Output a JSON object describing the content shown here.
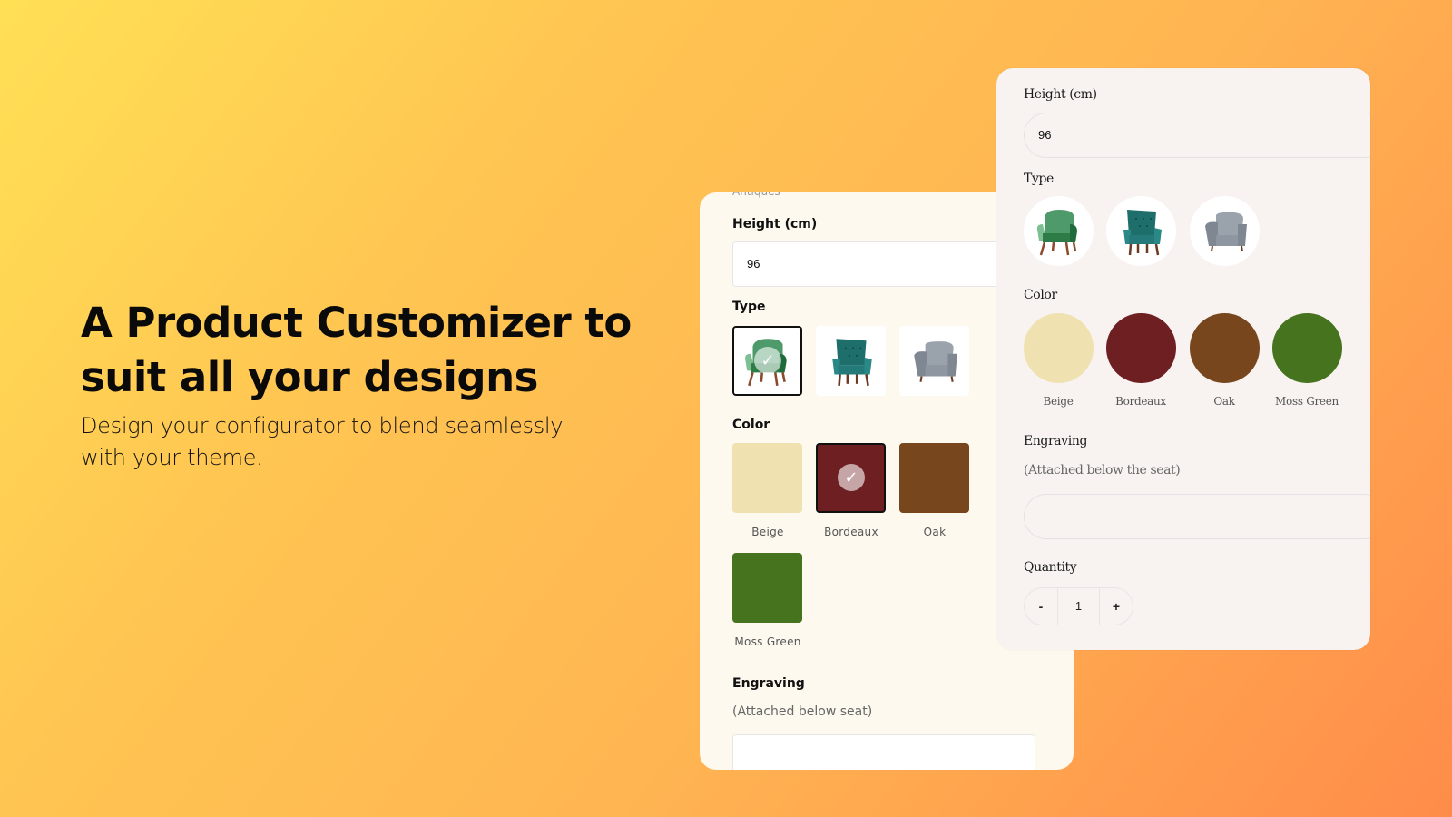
{
  "hero": {
    "title_line1": "A Product Customizer to",
    "title_line2": "suit all your designs",
    "subtitle_line1": "Design your configurator to blend seamlessly",
    "subtitle_line2": "with your theme."
  },
  "card_default": {
    "cut_label": "Antiques",
    "height_label": "Height (cm)",
    "height_value": "96",
    "type_label": "Type",
    "types": [
      {
        "name": "Green armchair",
        "icon": "armchair-green-icon",
        "selected": true
      },
      {
        "name": "Teal wingback chair",
        "icon": "armchair-teal-icon",
        "selected": false
      },
      {
        "name": "Grey armchair",
        "icon": "armchair-grey-icon",
        "selected": false
      }
    ],
    "color_label": "Color",
    "colors": [
      {
        "name": "Beige",
        "hex": "#f0e2b0",
        "selected": false
      },
      {
        "name": "Bordeaux",
        "hex": "#6e1f22",
        "selected": true
      },
      {
        "name": "Oak",
        "hex": "#77461d",
        "selected": false
      },
      {
        "name": "Moss Green",
        "hex": "#46731d",
        "selected": false
      }
    ],
    "engraving_label": "Engraving",
    "engraving_hint": "(Attached below seat)",
    "engraving_value": ""
  },
  "card_themed": {
    "height_label": "Height (cm)",
    "height_value": "96",
    "type_label": "Type",
    "types": [
      {
        "name": "Green armchair",
        "icon": "armchair-green-icon"
      },
      {
        "name": "Teal wingback chair",
        "icon": "armchair-teal-icon"
      },
      {
        "name": "Grey armchair",
        "icon": "armchair-grey-icon"
      }
    ],
    "color_label": "Color",
    "colors": [
      {
        "name": "Beige",
        "hex": "#f0e2b0"
      },
      {
        "name": "Bordeaux",
        "hex": "#6e1f22"
      },
      {
        "name": "Oak",
        "hex": "#77461d"
      },
      {
        "name": "Moss Green",
        "hex": "#46731d"
      }
    ],
    "engraving_label": "Engraving",
    "engraving_hint": "(Attached below the seat)",
    "engraving_value": "",
    "quantity_label": "Quantity",
    "quantity_value": "1",
    "minus_label": "-",
    "plus_label": "+"
  },
  "check_glyph": "✓"
}
